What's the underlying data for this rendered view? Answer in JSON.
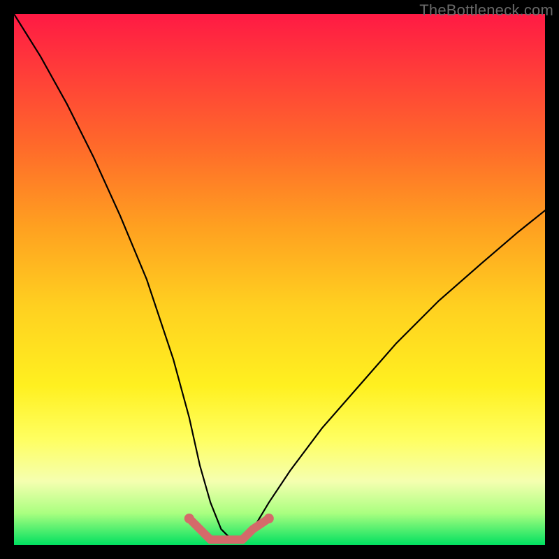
{
  "watermark": "TheBottleneck.com",
  "chart_data": {
    "type": "line",
    "title": "",
    "xlabel": "",
    "ylabel": "",
    "xlim": [
      0,
      100
    ],
    "ylim": [
      0,
      100
    ],
    "series": [
      {
        "name": "bottleneck-curve",
        "x": [
          0,
          5,
          10,
          15,
          20,
          25,
          30,
          33,
          35,
          37,
          39,
          41,
          43,
          45,
          48,
          52,
          58,
          65,
          72,
          80,
          88,
          95,
          100
        ],
        "y": [
          100,
          92,
          83,
          73,
          62,
          50,
          35,
          24,
          15,
          8,
          3,
          1,
          1,
          3,
          8,
          14,
          22,
          30,
          38,
          46,
          53,
          59,
          63
        ]
      },
      {
        "name": "tolerance-band",
        "x": [
          33,
          35,
          37,
          39,
          41,
          43,
          45,
          48
        ],
        "y": [
          5,
          3,
          1,
          1,
          1,
          1,
          3,
          5
        ]
      }
    ],
    "colors": {
      "curve": "#000000",
      "band": "#d46a6a"
    }
  }
}
